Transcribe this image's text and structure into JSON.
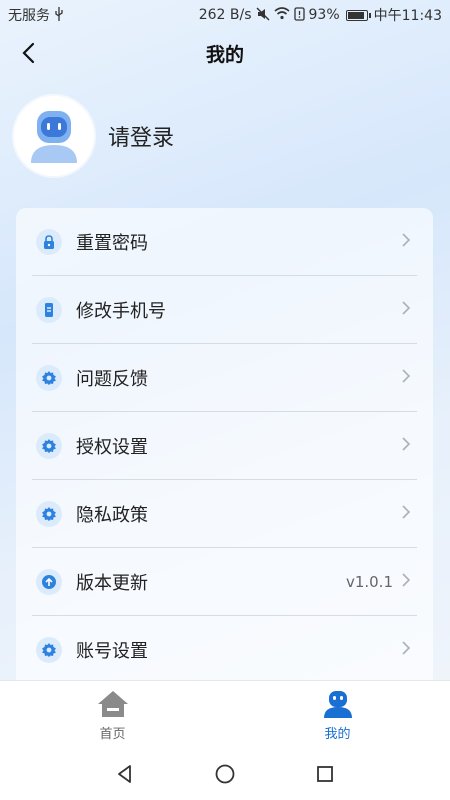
{
  "status_bar": {
    "carrier": "无服务",
    "speed": "262 B/s",
    "battery": "93%",
    "time": "中午11:43",
    "icons": [
      "usb-icon",
      "mute-icon",
      "wifi-icon",
      "battery-icon"
    ]
  },
  "header": {
    "title": "我的"
  },
  "profile": {
    "login_text": "请登录"
  },
  "menu": {
    "items": [
      {
        "label": "重置密码",
        "icon": "lock-icon",
        "value": ""
      },
      {
        "label": "修改手机号",
        "icon": "phone-icon",
        "value": ""
      },
      {
        "label": "问题反馈",
        "icon": "gear-icon",
        "value": ""
      },
      {
        "label": "授权设置",
        "icon": "gear-icon",
        "value": ""
      },
      {
        "label": "隐私政策",
        "icon": "gear-icon",
        "value": ""
      },
      {
        "label": "版本更新",
        "icon": "upload-icon",
        "value": "v1.0.1"
      },
      {
        "label": "账号设置",
        "icon": "gear-icon",
        "value": ""
      }
    ]
  },
  "tabbar": {
    "home": "首页",
    "mine": "我的"
  },
  "colors": {
    "accent": "#1a6fd3",
    "icon_bg": "#dcebfb",
    "icon_fg": "#2d82e0"
  }
}
